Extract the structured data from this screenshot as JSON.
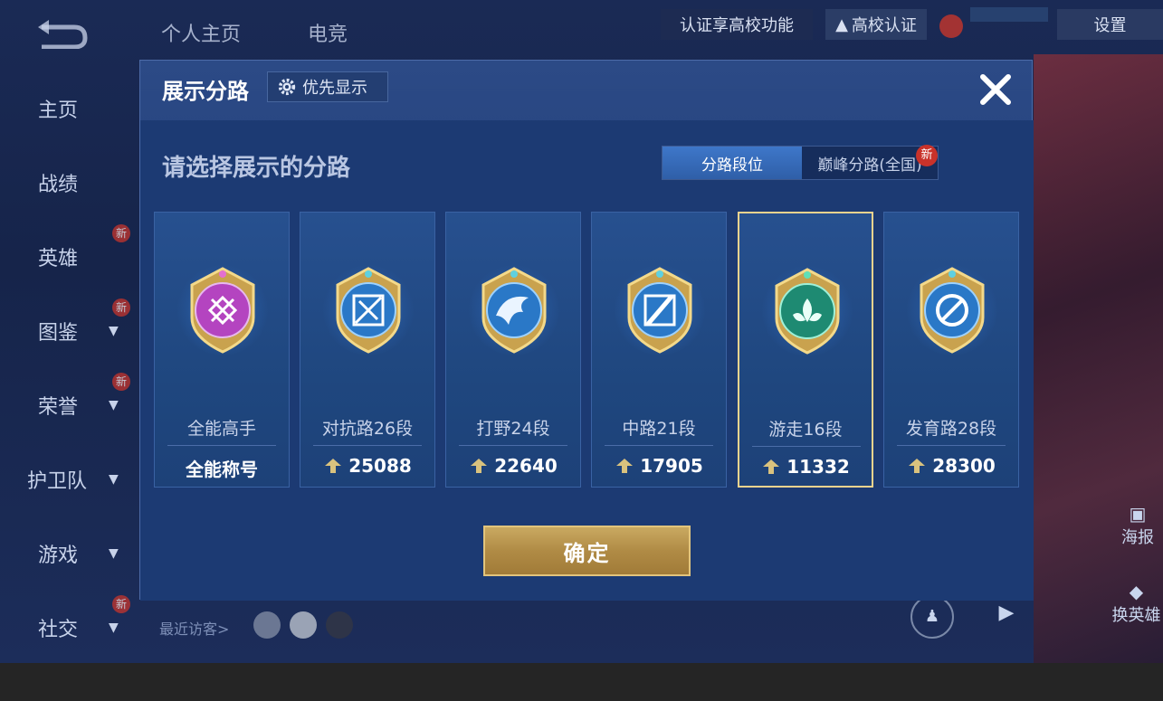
{
  "background": {
    "top_tabs": [
      "个人主页",
      "电竞"
    ],
    "top_right": {
      "verify_prompt": "认证享高校功能",
      "verify_button": "高校认证",
      "settings": "设置"
    },
    "side_menu": [
      {
        "label": "主页",
        "chevron": false,
        "new": false
      },
      {
        "label": "战绩",
        "chevron": false,
        "new": false
      },
      {
        "label": "英雄",
        "chevron": false,
        "new": true
      },
      {
        "label": "图鉴",
        "chevron": true,
        "new": true
      },
      {
        "label": "荣誉",
        "chevron": true,
        "new": true
      },
      {
        "label": "护卫队",
        "chevron": true,
        "new": false
      },
      {
        "label": "游戏",
        "chevron": true,
        "new": false
      },
      {
        "label": "社交",
        "chevron": true,
        "new": true
      }
    ],
    "new_badge": "新",
    "recent_visitors": "最近访客>",
    "right_buttons": {
      "poster": "海报",
      "swap_hero": "换英雄"
    }
  },
  "dialog": {
    "title": "展示分路",
    "priority_button": "优先显示",
    "prompt": "请选择展示的分路",
    "tabs": {
      "active": "分路段位",
      "inactive": "巅峰分路(全国)",
      "new_badge": "新"
    },
    "cards": [
      {
        "name": "全能高手",
        "score": "全能称号",
        "has_arrow": false,
        "emblem": "purple-emblem",
        "selected": false,
        "colors": [
          "#c04fc9",
          "#7a2187"
        ]
      },
      {
        "name": "对抗路26段",
        "score": "25088",
        "has_arrow": true,
        "emblem": "sword-emblem",
        "selected": false,
        "colors": [
          "#4da9e6",
          "#1e5fa3"
        ]
      },
      {
        "name": "打野24段",
        "score": "22640",
        "has_arrow": true,
        "emblem": "dragon-emblem",
        "selected": false,
        "colors": [
          "#4da9e6",
          "#1e5fa3"
        ]
      },
      {
        "name": "中路21段",
        "score": "17905",
        "has_arrow": true,
        "emblem": "staff-emblem",
        "selected": false,
        "colors": [
          "#4da9e6",
          "#1e5fa3"
        ]
      },
      {
        "name": "游走16段",
        "score": "11332",
        "has_arrow": true,
        "emblem": "wings-emblem",
        "selected": true,
        "colors": [
          "#3bb59a",
          "#16665a"
        ]
      },
      {
        "name": "发育路28段",
        "score": "28300",
        "has_arrow": true,
        "emblem": "bow-emblem",
        "selected": false,
        "colors": [
          "#4da9e6",
          "#1e5fa3"
        ]
      }
    ],
    "confirm_button": "确定"
  },
  "colors": {
    "accent_gold": "#e2c47c",
    "dialog_bg": "#22407a",
    "selected_border": "#f1d38e"
  }
}
